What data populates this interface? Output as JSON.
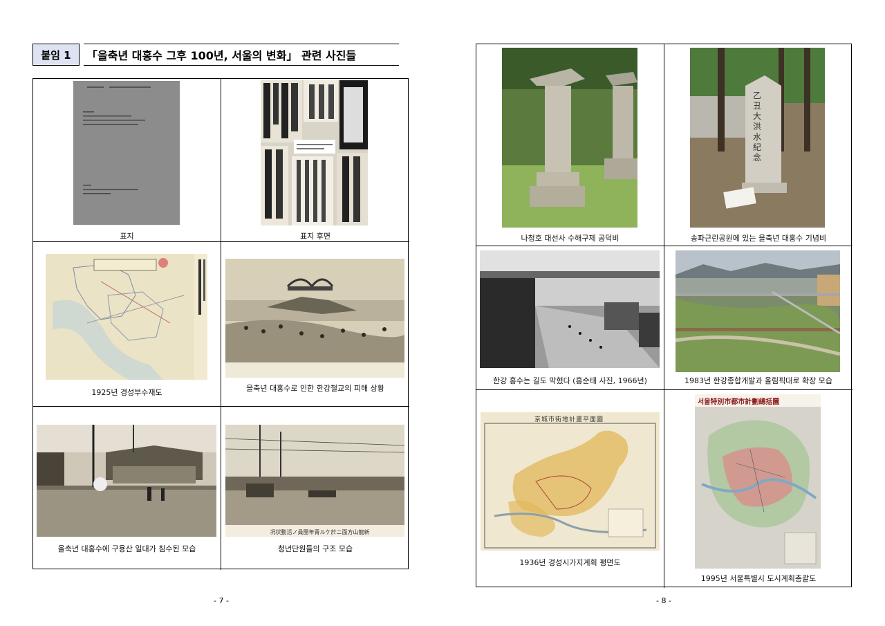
{
  "header": {
    "tag": "붙임 1",
    "title": "「을축년 대홍수 그후 100년, 서울의 변화」 관련 사진들"
  },
  "left": {
    "page_number": "- 7 -",
    "captions": [
      "표지",
      "표지 후면",
      "1925년 경성부수재도",
      "을축년 대홍수로 인한 한강철교의 피해 상황",
      "을축년 대홍수에 구용산 일대가 침수된 모습",
      "청년단원들의 구조 모습"
    ],
    "photo_text": {
      "newspaper_headline": "洪水의 新聞",
      "map_title": "京城府水災圖",
      "relief_caption": "况状動活ノ員團年青ルケ於ニ面方山龍新"
    }
  },
  "right": {
    "page_number": "- 8 -",
    "captions": [
      "나청호 대선사 수해구제 공덕비",
      "송파근린공원에 있는 을축년 대홍수 기념비",
      "한강 홍수는 길도 막혔다 (홍순태 사진, 1966년)",
      "1983년 한강종합개발과 올림픽대로 확장 모습",
      "1936년 경성시가지계획 평면도",
      "1995년 서울특별시 도시계획총괄도"
    ],
    "photo_text": {
      "stele_chars": "乙丑大洪水紀念",
      "map1936_title": "京城市街地計畫平面圖",
      "map1995_title": "서울特別市都市計劃總括圖"
    }
  }
}
